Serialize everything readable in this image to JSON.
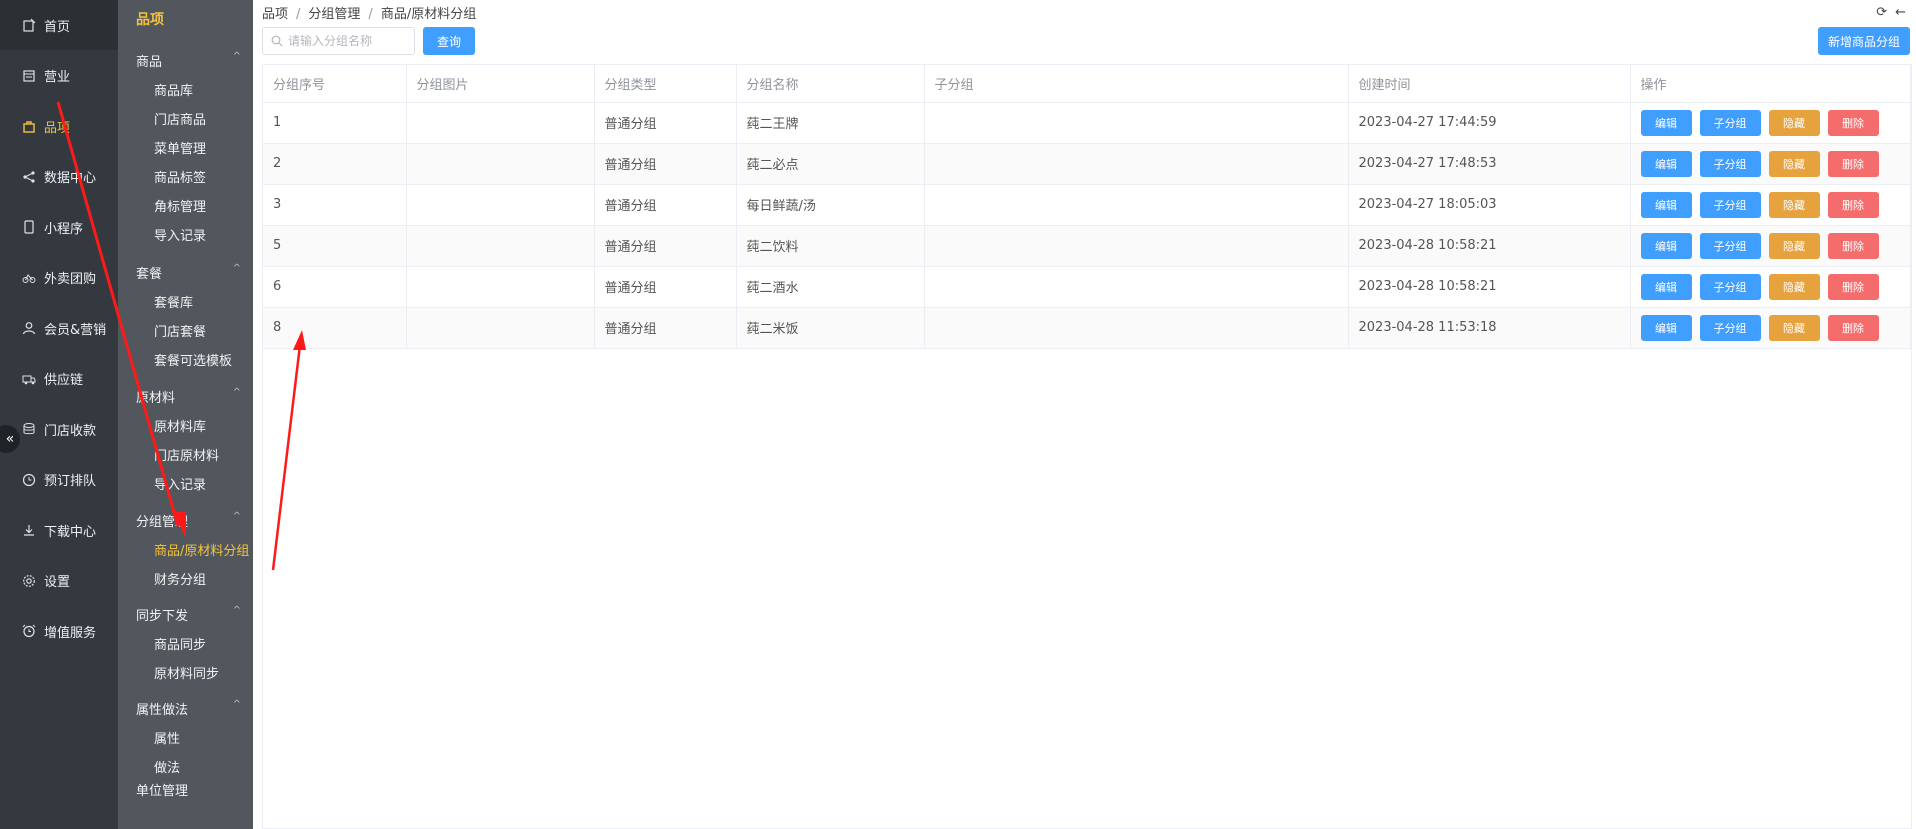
{
  "nav1": {
    "items": [
      {
        "label": "首页",
        "icon": "home-icon"
      },
      {
        "label": "营业",
        "icon": "calendar-icon"
      },
      {
        "label": "品项",
        "icon": "bag-icon"
      },
      {
        "label": "数据中心",
        "icon": "share-icon"
      },
      {
        "label": "小程序",
        "icon": "phone-icon"
      },
      {
        "label": "外卖团购",
        "icon": "bike-icon"
      },
      {
        "label": "会员&营销",
        "icon": "user-icon"
      },
      {
        "label": "供应链",
        "icon": "truck-icon"
      },
      {
        "label": "门店收款",
        "icon": "coins-icon"
      },
      {
        "label": "预订排队",
        "icon": "clock-icon"
      },
      {
        "label": "下载中心",
        "icon": "download-icon"
      },
      {
        "label": "设置",
        "icon": "gear-icon"
      },
      {
        "label": "增值服务",
        "icon": "alarm-icon"
      }
    ],
    "active_color": "#f3c33d",
    "collapse_glyph": "«"
  },
  "nav2": {
    "title": "品项",
    "groups": [
      {
        "label": "商品",
        "items": [
          "商品库",
          "门店商品",
          "菜单管理",
          "商品标签",
          "角标管理",
          "导入记录"
        ]
      },
      {
        "label": "套餐",
        "items": [
          "套餐库",
          "门店套餐",
          "套餐可选模板"
        ]
      },
      {
        "label": "原材料",
        "items": [
          "原材料库",
          "门店原材料",
          "导入记录"
        ]
      },
      {
        "label": "分组管理",
        "items": [
          "商品/原材料分组",
          "财务分组"
        ]
      },
      {
        "label": "同步下发",
        "items": [
          "商品同步",
          "原材料同步"
        ]
      },
      {
        "label": "属性做法",
        "items": [
          "属性",
          "做法"
        ]
      }
    ],
    "bottom_item": "单位管理",
    "caret": "^"
  },
  "breadcrumb": [
    "品项",
    "分组管理",
    "商品/原材料分组"
  ],
  "breadcrumb_sep": "/",
  "top_icons": {
    "refresh": "⟳",
    "back": "←"
  },
  "search": {
    "placeholder": "请输入分组名称",
    "value": ""
  },
  "buttons": {
    "query": "查询",
    "add": "新增商品分组"
  },
  "table": {
    "headers": [
      "分组序号",
      "分组图片",
      "分组类型",
      "分组名称",
      "子分组",
      "创建时间",
      "操作"
    ],
    "rows": [
      {
        "no": "1",
        "type": "普通分组",
        "name": "莼二王牌",
        "time": "2023-04-27 17:44:59"
      },
      {
        "no": "2",
        "type": "普通分组",
        "name": "莼二必点",
        "time": "2023-04-27 17:48:53"
      },
      {
        "no": "3",
        "type": "普通分组",
        "name": "每日鲜蔬/汤",
        "time": "2023-04-27 18:05:03"
      },
      {
        "no": "5",
        "type": "普通分组",
        "name": "莼二饮料",
        "time": "2023-04-28 10:58:21"
      },
      {
        "no": "6",
        "type": "普通分组",
        "name": "莼二酒水",
        "time": "2023-04-28 10:58:21"
      },
      {
        "no": "8",
        "type": "普通分组",
        "name": "莼二米饭",
        "time": "2023-04-28 11:53:18"
      }
    ],
    "ops": {
      "edit": "编辑",
      "sub": "子分组",
      "hide": "隐藏",
      "del": "删除"
    }
  },
  "colors": {
    "primary": "#409eff",
    "warning": "#e6a23c",
    "danger": "#f56c6c",
    "annotation": "#ff1a1a"
  }
}
